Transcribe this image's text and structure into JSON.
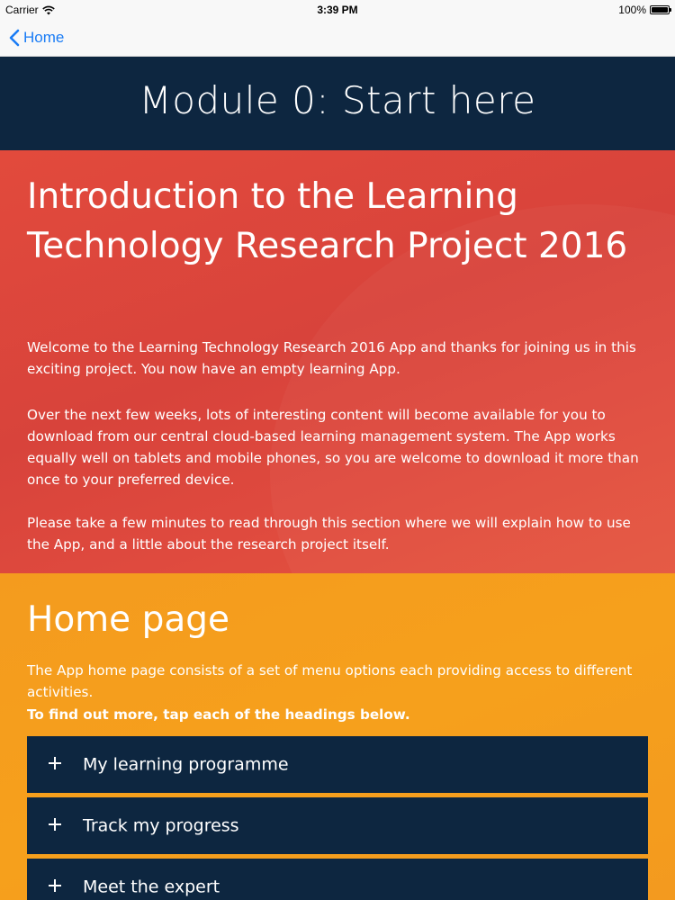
{
  "status_bar": {
    "carrier": "Carrier",
    "time": "3:39 PM",
    "battery": "100%"
  },
  "nav": {
    "back_label": "Home"
  },
  "module": {
    "title": "Module 0: Start here"
  },
  "intro": {
    "title": "Introduction to the Learning Technology Research Project 2016",
    "paragraphs": [
      "Welcome to the Learning Technology Research 2016 App and thanks for joining us in this exciting project. You now have an empty learning App.",
      "Over the next few weeks, lots of interesting content will become available for you to download from our central cloud-based learning management system. The App works equally well on tablets and mobile phones, so you are welcome to download it more than once to your preferred device.",
      "Please take a few minutes to read through this section where we will explain how to use the App, and a little about the research project itself."
    ]
  },
  "home": {
    "title": "Home page",
    "intro": "The App home page consists of a set of menu options each providing access to different activities.",
    "instruction": "To find out more, tap each of the headings below.",
    "items": [
      {
        "label": "My learning programme"
      },
      {
        "label": "Track my progress"
      },
      {
        "label": "Meet the expert"
      }
    ]
  },
  "colors": {
    "navy": "#0d2640",
    "red": "#dc463c",
    "orange": "#f59d1e",
    "ios_blue": "#1a7cf5"
  }
}
